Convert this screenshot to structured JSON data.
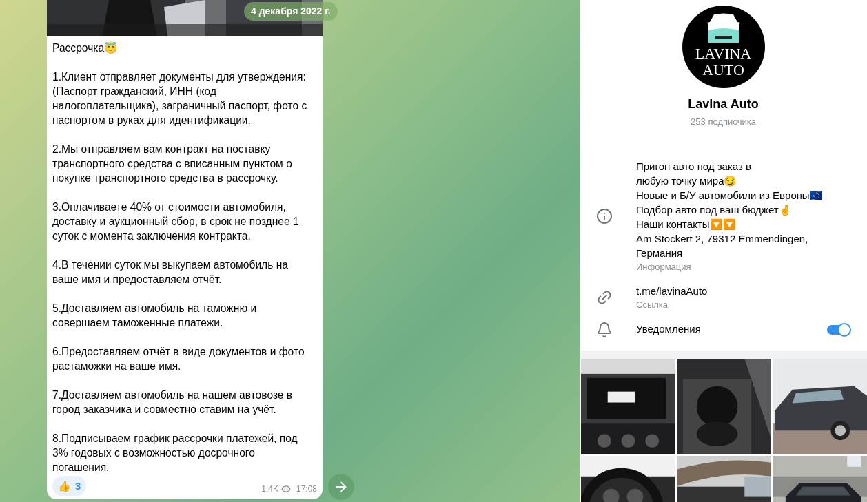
{
  "chat": {
    "date_badge": "4 декабря 2022 г.",
    "message": {
      "paragraphs": [
        "Рассрочка😇",
        "1.Клиент отправляет документы для утверждения: (Паспорт гражданский, ИНН (код налогоплательщика), заграничный паспорт, фото с паспортом в руках для идентификации.",
        "2.Мы отправляем вам контракт на поставку транспортного средства с вписанным пунктом о покупке транспортного средства в рассрочку.",
        "3.Оплачиваете 40% от стоимости автомобиля, доставку и аукционный сбор, в срок не позднее 1 суток с момента заключения контракта.",
        "4.В течении суток мы выкупаем автомобиль на ваше имя и предоставляем отчёт.",
        "5.Доставляем автомобиль на таможню и совершаем таможенные платежи.",
        "6.Предоставляем отчёт в виде документов и фото растаможки на ваше имя.",
        "7.Доставляем автомобиль на нашем автовозе в город заказчика и совместно ставим на учёт.",
        "8.Подписываем график рассрочки платежей, под 3% годовых с возможностью досрочного погашения."
      ],
      "reactions": [
        {
          "emoji": "👍",
          "count": "3"
        }
      ],
      "views": "1.4K",
      "time": "17:08"
    }
  },
  "channel": {
    "logo": {
      "line1": "LAVINA",
      "line2": "AUTO"
    },
    "name": "Lavina Auto",
    "subscribers": "253 подписчика",
    "info": {
      "lines": [
        "Пригон авто под заказ в",
        "любую точку мира😏",
        "Новые и Б/У автомобили из Европы🇪🇺",
        "Подбор авто под ваш бюджет🤞",
        "Наши контакты🔽🔽",
        "Am Stockert 2, 79312 Emmendingen, Германия"
      ],
      "label": "Информация"
    },
    "link": {
      "value": "t.me/lavinaAuto",
      "label": "Ссылка"
    },
    "notifications": {
      "label": "Уведомления",
      "on": true
    }
  }
}
